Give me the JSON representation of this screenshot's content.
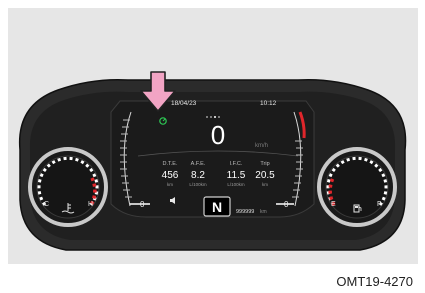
{
  "screen": {
    "date": "18/04/23",
    "time": "10:12",
    "speed": "0",
    "speed_unit": "km/h",
    "info": [
      {
        "label": "D.T.E.",
        "value": "456",
        "unit": "km"
      },
      {
        "label": "A.F.E.",
        "value": "8.2",
        "unit": "L/100km"
      },
      {
        "label": "I.F.C.",
        "value": "11.5",
        "unit": "L/100km"
      },
      {
        "label": "Trip",
        "value": "20.5",
        "unit": "km"
      }
    ],
    "gear": "N",
    "odometer": "999999",
    "odometer_unit": "km",
    "left_bar_end": "0",
    "right_bar_end": "0"
  },
  "temp_gauge": {
    "low": "C",
    "high": "H"
  },
  "fuel_gauge": {
    "low": "E",
    "high": "F"
  },
  "caption": "OMT19-4270",
  "colors": {
    "bezel": "#2a2a2a",
    "screen": "#1b1b1b",
    "accent_red": "#e0262b",
    "arrow": "#f2a4c4",
    "indicator_green": "#2ecc55",
    "background_panel": "#e6e6e6"
  },
  "icons": {
    "arrow": "pointer-arrow-icon",
    "indicator": "cruise-indicator-icon",
    "temp": "coolant-temp-icon",
    "fuel": "fuel-pump-icon",
    "sound": "speaker-icon"
  }
}
